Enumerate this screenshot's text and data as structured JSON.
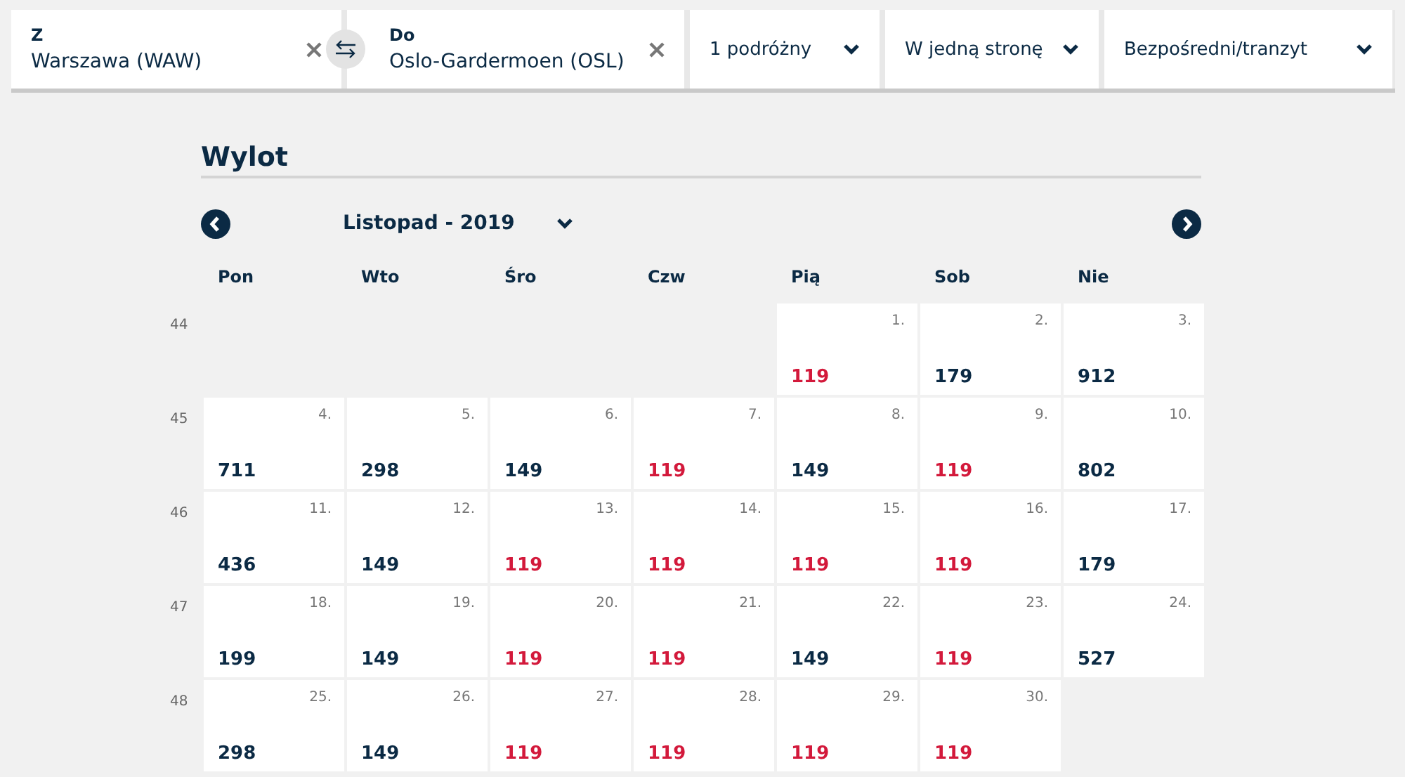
{
  "search_bar": {
    "from": {
      "label": "Z",
      "value": "Warszawa (WAW)"
    },
    "to": {
      "label": "Do",
      "value": "Oslo-Gardermoen (OSL)"
    },
    "dropdowns": [
      "1 podróżny",
      "W jedną stronę",
      "Bezpośredni/tranzyt"
    ]
  },
  "calendar": {
    "title": "Wylot",
    "month": "Listopad - 2019",
    "weekdays": [
      "Pon",
      "Wto",
      "Śro",
      "Czw",
      "Pią",
      "Sob",
      "Nie"
    ],
    "weeks": [
      {
        "week": "44",
        "days": [
          {
            "kind": "blank"
          },
          {
            "kind": "blank"
          },
          {
            "kind": "blank"
          },
          {
            "kind": "blank"
          },
          {
            "kind": "day",
            "date": "1.",
            "price": "119",
            "cheapest": true
          },
          {
            "kind": "day",
            "date": "2.",
            "price": "179",
            "cheapest": false
          },
          {
            "kind": "day",
            "date": "3.",
            "price": "912",
            "cheapest": false
          }
        ]
      },
      {
        "week": "45",
        "days": [
          {
            "kind": "day",
            "date": "4.",
            "price": "711",
            "cheapest": false
          },
          {
            "kind": "day",
            "date": "5.",
            "price": "298",
            "cheapest": false
          },
          {
            "kind": "day",
            "date": "6.",
            "price": "149",
            "cheapest": false
          },
          {
            "kind": "day",
            "date": "7.",
            "price": "119",
            "cheapest": true
          },
          {
            "kind": "day",
            "date": "8.",
            "price": "149",
            "cheapest": false
          },
          {
            "kind": "day",
            "date": "9.",
            "price": "119",
            "cheapest": true
          },
          {
            "kind": "day",
            "date": "10.",
            "price": "802",
            "cheapest": false
          }
        ]
      },
      {
        "week": "46",
        "days": [
          {
            "kind": "day",
            "date": "11.",
            "price": "436",
            "cheapest": false
          },
          {
            "kind": "day",
            "date": "12.",
            "price": "149",
            "cheapest": false
          },
          {
            "kind": "day",
            "date": "13.",
            "price": "119",
            "cheapest": true
          },
          {
            "kind": "day",
            "date": "14.",
            "price": "119",
            "cheapest": true
          },
          {
            "kind": "day",
            "date": "15.",
            "price": "119",
            "cheapest": true
          },
          {
            "kind": "day",
            "date": "16.",
            "price": "119",
            "cheapest": true
          },
          {
            "kind": "day",
            "date": "17.",
            "price": "179",
            "cheapest": false
          }
        ]
      },
      {
        "week": "47",
        "days": [
          {
            "kind": "day",
            "date": "18.",
            "price": "199",
            "cheapest": false
          },
          {
            "kind": "day",
            "date": "19.",
            "price": "149",
            "cheapest": false
          },
          {
            "kind": "day",
            "date": "20.",
            "price": "119",
            "cheapest": true
          },
          {
            "kind": "day",
            "date": "21.",
            "price": "119",
            "cheapest": true
          },
          {
            "kind": "day",
            "date": "22.",
            "price": "149",
            "cheapest": false
          },
          {
            "kind": "day",
            "date": "23.",
            "price": "119",
            "cheapest": true
          },
          {
            "kind": "day",
            "date": "24.",
            "price": "527",
            "cheapest": false
          }
        ]
      },
      {
        "week": "48",
        "days": [
          {
            "kind": "day",
            "date": "25.",
            "price": "298",
            "cheapest": false
          },
          {
            "kind": "day",
            "date": "26.",
            "price": "149",
            "cheapest": false
          },
          {
            "kind": "day",
            "date": "27.",
            "price": "119",
            "cheapest": true
          },
          {
            "kind": "day",
            "date": "28.",
            "price": "119",
            "cheapest": true
          },
          {
            "kind": "day",
            "date": "29.",
            "price": "119",
            "cheapest": true
          },
          {
            "kind": "day",
            "date": "30.",
            "price": "119",
            "cheapest": true
          },
          {
            "kind": "blank"
          }
        ]
      }
    ]
  }
}
